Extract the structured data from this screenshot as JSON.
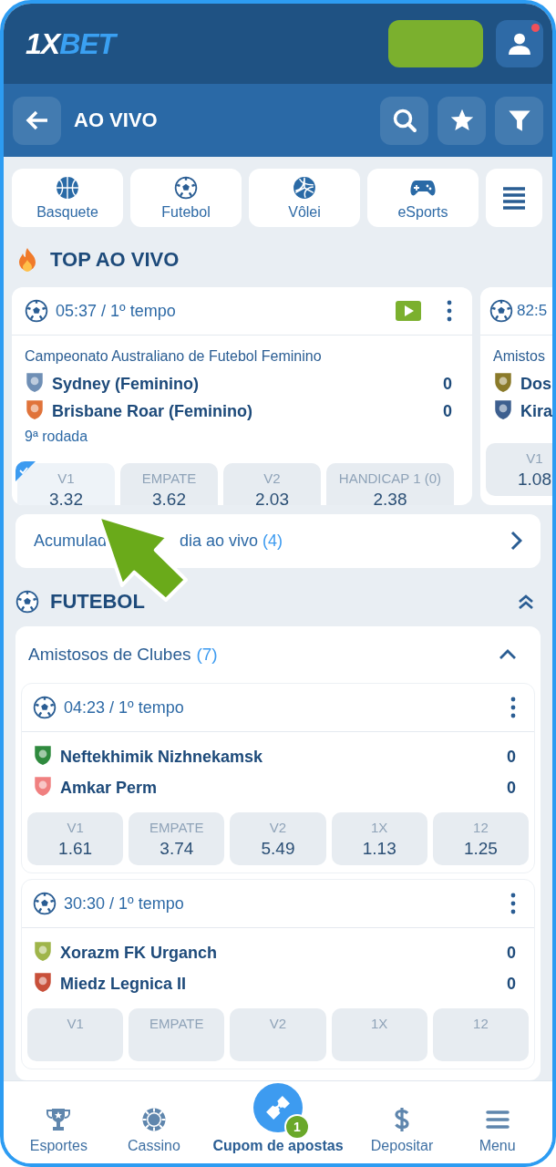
{
  "header": {
    "logo_start": "1X",
    "logo_end": "BET",
    "profile": {
      "notification": true
    }
  },
  "subheader": {
    "title": "AO VIVO"
  },
  "sports": [
    {
      "label": "Basquete"
    },
    {
      "label": "Futebol"
    },
    {
      "label": "Vôlei"
    },
    {
      "label": "eSports"
    }
  ],
  "top_live": {
    "title": "TOP AO VIVO",
    "cards": [
      {
        "time": "05:37 / 1º tempo",
        "stream": true,
        "league": "Campeonato Australiano de Futebol Feminino",
        "teams": [
          {
            "name": "Sydney (Feminino)",
            "score": "0",
            "color": "#6f8fb5"
          },
          {
            "name": "Brisbane Roar (Feminino)",
            "score": "0",
            "color": "#e0733a"
          }
        ],
        "round": "9ª rodada",
        "odds": [
          {
            "label": "V1",
            "value": "3.32",
            "selected": true
          },
          {
            "label": "EMPATE",
            "value": "3.62",
            "selected": false
          },
          {
            "label": "V2",
            "value": "2.03",
            "selected": false
          },
          {
            "label": "HANDICAP 1 (0)",
            "value": "2.38",
            "selected": false
          }
        ]
      },
      {
        "time": "82:5",
        "stream": false,
        "league": "Amistos",
        "teams": [
          {
            "name": "Dos",
            "color": "#8a7a2a"
          },
          {
            "name": "Kira",
            "color": "#3d5f8f"
          }
        ],
        "odds": [
          {
            "label": "V1",
            "value": "1.08",
            "selected": false
          }
        ]
      }
    ]
  },
  "express": {
    "text_start": "Acumulad",
    "text_end": "dia ao vivo",
    "count": "(4)"
  },
  "football": {
    "title": "FUTEBOL",
    "leagues": [
      {
        "name": "Amistosos de Clubes",
        "count": "(7)",
        "expanded": true,
        "matches": [
          {
            "time": "04:23 / 1º tempo",
            "teams": [
              {
                "name": "Neftekhimik Nizhnekamsk",
                "score": "0",
                "color": "#2f8a3e"
              },
              {
                "name": "Amkar Perm",
                "score": "0",
                "color": "#f08080"
              }
            ],
            "odds": [
              {
                "label": "V1",
                "value": "1.61"
              },
              {
                "label": "EMPATE",
                "value": "3.74"
              },
              {
                "label": "V2",
                "value": "5.49"
              },
              {
                "label": "1X",
                "value": "1.13"
              },
              {
                "label": "12",
                "value": "1.25"
              }
            ]
          },
          {
            "time": "30:30 / 1º tempo",
            "teams": [
              {
                "name": "Xorazm FK Urganch",
                "score": "0",
                "color": "#9fb54a"
              },
              {
                "name": "Miedz Legnica II",
                "score": "0",
                "color": "#c8503a"
              }
            ],
            "odds": [
              {
                "label": "V1"
              },
              {
                "label": "EMPATE"
              },
              {
                "label": "V2"
              },
              {
                "label": "1X"
              },
              {
                "label": "12"
              }
            ]
          }
        ]
      }
    ]
  },
  "nav": [
    {
      "label": "Esportes",
      "selected": false
    },
    {
      "label": "Cassino",
      "selected": false
    },
    {
      "label": "Cupom de apostas",
      "selected": true,
      "badge": "1"
    },
    {
      "label": "Depositar",
      "selected": false
    },
    {
      "label": "Menu",
      "selected": false
    }
  ]
}
